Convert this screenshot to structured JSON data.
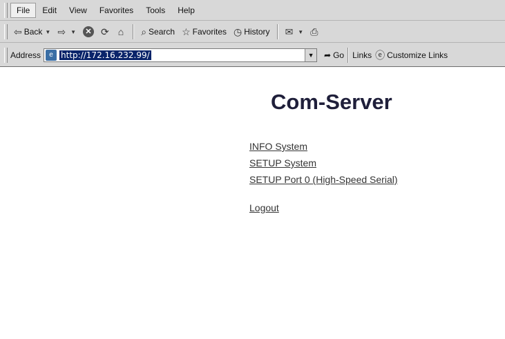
{
  "menu": {
    "items": [
      "File",
      "Edit",
      "View",
      "Favorites",
      "Tools",
      "Help"
    ]
  },
  "toolbar": {
    "back": "Back",
    "search": "Search",
    "favorites": "Favorites",
    "history": "History"
  },
  "address_bar": {
    "label": "Address",
    "url": "http://172.16.232.99/",
    "go": "Go",
    "links": "Links",
    "customize_links": "Customize Links"
  },
  "page": {
    "title": "Com-Server",
    "links": [
      "INFO System",
      "SETUP System",
      "SETUP Port 0 (High-Speed Serial)"
    ],
    "logout": "Logout"
  }
}
